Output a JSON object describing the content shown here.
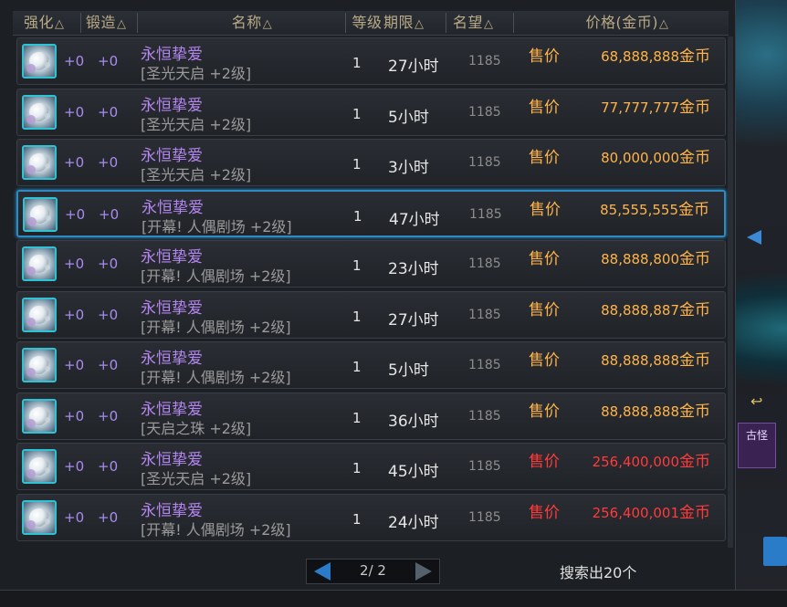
{
  "header": {
    "enhance": "强化",
    "forge": "锻造",
    "name": "名称",
    "level": "等级",
    "duration": "期限",
    "fame": "名望",
    "price": "价格(金币)",
    "sort_glyph": "△"
  },
  "rows": [
    {
      "enhance": "+0",
      "forge": "+0",
      "name": "永恒挚爱",
      "sub": "[圣光天启 +2级]",
      "level": "1",
      "time": "27小时",
      "fame": "1185",
      "sell": "售价",
      "price": "68,888,888",
      "unit": "金币",
      "color": "#ffb44a"
    },
    {
      "enhance": "+0",
      "forge": "+0",
      "name": "永恒挚爱",
      "sub": "[圣光天启 +2级]",
      "level": "1",
      "time": "5小时",
      "fame": "1185",
      "sell": "售价",
      "price": "77,777,777",
      "unit": "金币",
      "color": "#ffb44a"
    },
    {
      "enhance": "+0",
      "forge": "+0",
      "name": "永恒挚爱",
      "sub": "[圣光天启 +2级]",
      "level": "1",
      "time": "3小时",
      "fame": "1185",
      "sell": "售价",
      "price": "80,000,000",
      "unit": "金币",
      "color": "#ffb44a"
    },
    {
      "enhance": "+0",
      "forge": "+0",
      "name": "永恒挚爱",
      "sub": "[开幕! 人偶剧场 +2级]",
      "level": "1",
      "time": "47小时",
      "fame": "1185",
      "sell": "售价",
      "price": "85,555,555",
      "unit": "金币",
      "color": "#ffb44a",
      "selected": true
    },
    {
      "enhance": "+0",
      "forge": "+0",
      "name": "永恒挚爱",
      "sub": "[开幕! 人偶剧场 +2级]",
      "level": "1",
      "time": "23小时",
      "fame": "1185",
      "sell": "售价",
      "price": "88,888,800",
      "unit": "金币",
      "color": "#ffb44a"
    },
    {
      "enhance": "+0",
      "forge": "+0",
      "name": "永恒挚爱",
      "sub": "[开幕! 人偶剧场 +2级]",
      "level": "1",
      "time": "27小时",
      "fame": "1185",
      "sell": "售价",
      "price": "88,888,887",
      "unit": "金币",
      "color": "#ffb44a"
    },
    {
      "enhance": "+0",
      "forge": "+0",
      "name": "永恒挚爱",
      "sub": "[开幕! 人偶剧场 +2级]",
      "level": "1",
      "time": "5小时",
      "fame": "1185",
      "sell": "售价",
      "price": "88,888,888",
      "unit": "金币",
      "color": "#ffb44a"
    },
    {
      "enhance": "+0",
      "forge": "+0",
      "name": "永恒挚爱",
      "sub": "[天启之珠 +2级]",
      "level": "1",
      "time": "36小时",
      "fame": "1185",
      "sell": "售价",
      "price": "88,888,888",
      "unit": "金币",
      "color": "#ffb44a"
    },
    {
      "enhance": "+0",
      "forge": "+0",
      "name": "永恒挚爱",
      "sub": "[圣光天启 +2级]",
      "level": "1",
      "time": "45小时",
      "fame": "1185",
      "sell": "售价",
      "price": "256,400,000",
      "unit": "金币",
      "color": "#ff3b3b"
    },
    {
      "enhance": "+0",
      "forge": "+0",
      "name": "永恒挚爱",
      "sub": "[开幕! 人偶剧场 +2级]",
      "level": "1",
      "time": "24小时",
      "fame": "1185",
      "sell": "售价",
      "price": "256,400,001",
      "unit": "金币",
      "color": "#ff3b3b"
    }
  ],
  "pager": {
    "text": "2/ 2"
  },
  "result": "搜索出20个",
  "side": {
    "button_label": "古怪"
  },
  "icons": {
    "item": "eternal-love-item-icon",
    "prev": "prev-page-arrow-icon",
    "next": "next-page-arrow-icon"
  },
  "colors": {
    "gold": "#ffb44a",
    "red": "#ff3b3b",
    "purple": "#b486f0",
    "selected_border": "#2f8ac4"
  }
}
